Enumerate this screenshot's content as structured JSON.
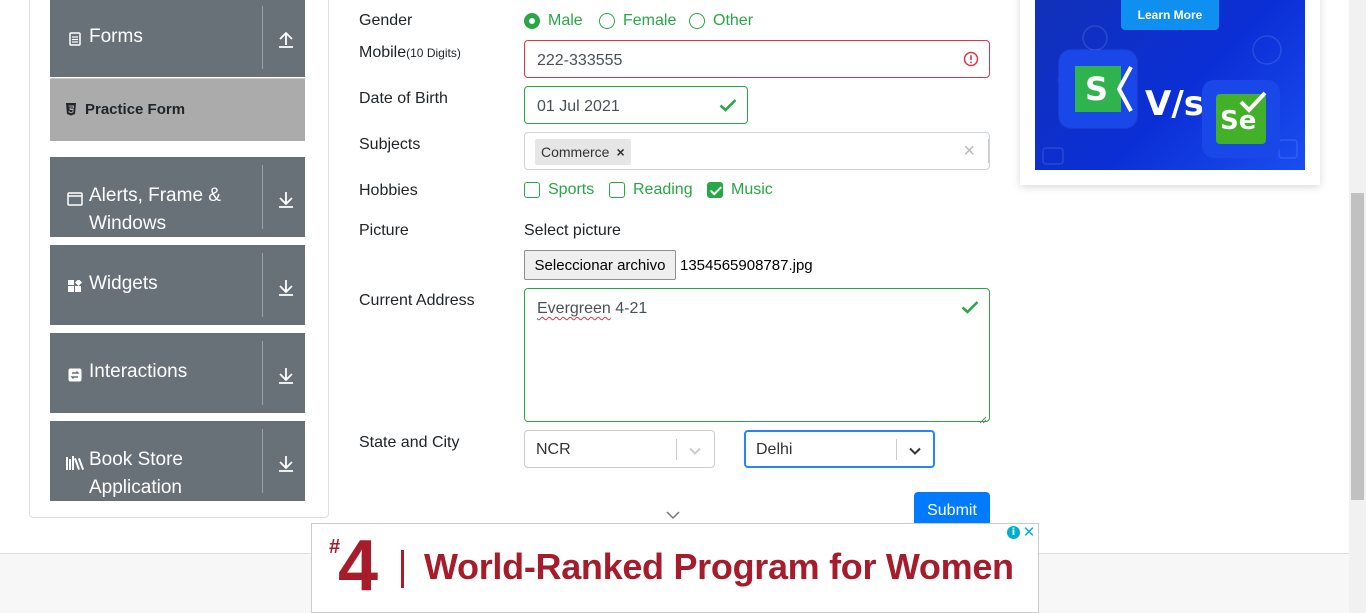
{
  "sidebar": {
    "groups": [
      {
        "title": "Forms",
        "icon": "document-icon"
      },
      {
        "title": "Alerts, Frame &",
        "title2": "Windows",
        "icon": "window-icon"
      },
      {
        "title": "Widgets",
        "icon": "widgets-icon"
      },
      {
        "title": "Interactions",
        "icon": "interactions-icon"
      },
      {
        "title": "Book Store",
        "title2": "Application",
        "icon": "books-icon"
      }
    ],
    "active_item": "Practice Form"
  },
  "form": {
    "gender": {
      "label": "Gender",
      "options": [
        "Male",
        "Female",
        "Other"
      ],
      "selected": "Male"
    },
    "mobile": {
      "label": "Mobile",
      "hint": "(10 Digits)",
      "value": "222-333555"
    },
    "dob": {
      "label": "Date of Birth",
      "value": "01 Jul 2021"
    },
    "subjects": {
      "label": "Subjects",
      "chips": [
        "Commerce"
      ],
      "clear": "×",
      "chip_remove": "×"
    },
    "hobbies": {
      "label": "Hobbies",
      "options": [
        "Sports",
        "Reading",
        "Music"
      ],
      "checked": [
        "Music"
      ]
    },
    "picture": {
      "label": "Picture",
      "prompt": "Select picture",
      "button": "Seleccionar archivo",
      "file": "1354565908787.jpg"
    },
    "address": {
      "label": "Current Address",
      "value_word": "Evergreen",
      "value_rest": " 4-21"
    },
    "state_city": {
      "label": "State and City",
      "state": "NCR",
      "city": "Delhi"
    },
    "submit": "Submit"
  },
  "ads": {
    "side": {
      "cta": "Learn More",
      "logo_left": "S",
      "vs": "V/s",
      "logo_right": "Se"
    },
    "bottom": {
      "hash": "#",
      "number": "4",
      "text": "World-Ranked Program for Women",
      "info": "i",
      "close": "✕"
    }
  },
  "colors": {
    "valid": "#28a745",
    "invalid": "#dc3545",
    "primary": "#007bff",
    "sidebar": "#687078",
    "ad_red": "#a61c2b"
  }
}
